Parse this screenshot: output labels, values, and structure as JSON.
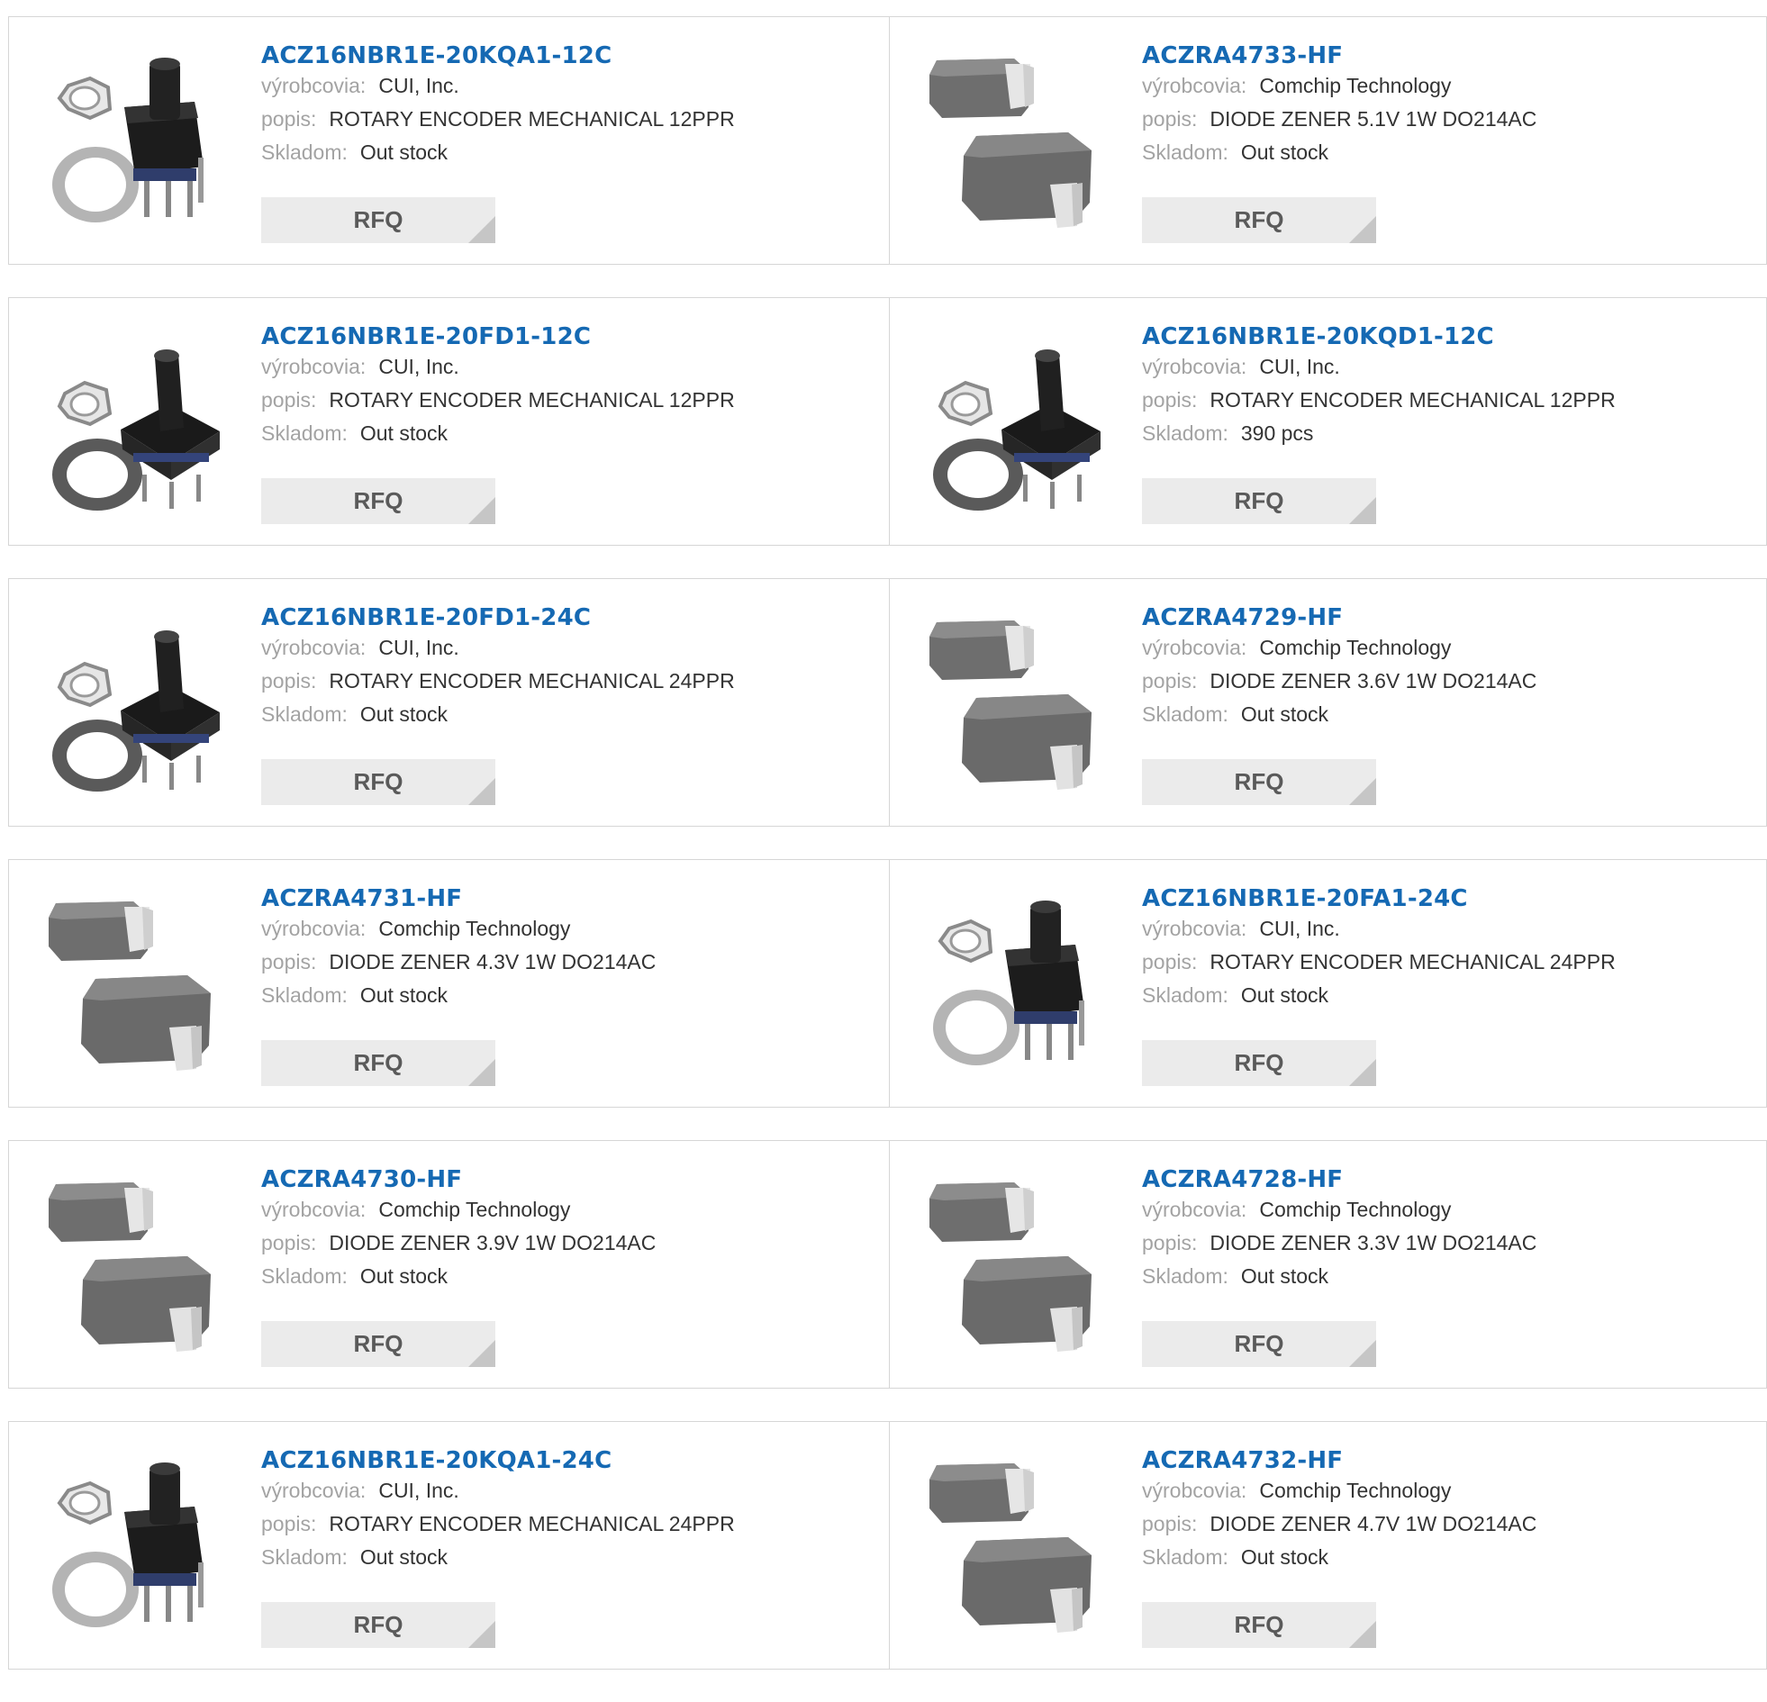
{
  "labels": {
    "manufacturer": "výrobcovia:",
    "description": "popis:",
    "stock": "Skladom:",
    "rfq": "RFQ"
  },
  "products": [
    {
      "part": "ACZ16NBR1E-20KQA1-12C",
      "manufacturer": "CUI, Inc.",
      "description": "ROTARY ENCODER MECHANICAL 12PPR",
      "stock": "Out stock",
      "image": "rotary-encoder"
    },
    {
      "part": "ACZRA4733-HF",
      "manufacturer": "Comchip Technology",
      "description": "DIODE ZENER 5.1V 1W DO214AC",
      "stock": "Out stock",
      "image": "zener-diode"
    },
    {
      "part": "ACZ16NBR1E-20FD1-12C",
      "manufacturer": "CUI, Inc.",
      "description": "ROTARY ENCODER MECHANICAL 12PPR",
      "stock": "Out stock",
      "image": "rotary-encoder-d"
    },
    {
      "part": "ACZ16NBR1E-20KQD1-12C",
      "manufacturer": "CUI, Inc.",
      "description": "ROTARY ENCODER MECHANICAL 12PPR",
      "stock": "390 pcs",
      "image": "rotary-encoder-d"
    },
    {
      "part": "ACZ16NBR1E-20FD1-24C",
      "manufacturer": "CUI, Inc.",
      "description": "ROTARY ENCODER MECHANICAL 24PPR",
      "stock": "Out stock",
      "image": "rotary-encoder-d"
    },
    {
      "part": "ACZRA4729-HF",
      "manufacturer": "Comchip Technology",
      "description": "DIODE ZENER 3.6V 1W DO214AC",
      "stock": "Out stock",
      "image": "zener-diode"
    },
    {
      "part": "ACZRA4731-HF",
      "manufacturer": "Comchip Technology",
      "description": "DIODE ZENER 4.3V 1W DO214AC",
      "stock": "Out stock",
      "image": "zener-diode"
    },
    {
      "part": "ACZ16NBR1E-20FA1-24C",
      "manufacturer": "CUI, Inc.",
      "description": "ROTARY ENCODER MECHANICAL 24PPR",
      "stock": "Out stock",
      "image": "rotary-encoder"
    },
    {
      "part": "ACZRA4730-HF",
      "manufacturer": "Comchip Technology",
      "description": "DIODE ZENER 3.9V 1W DO214AC",
      "stock": "Out stock",
      "image": "zener-diode"
    },
    {
      "part": "ACZRA4728-HF",
      "manufacturer": "Comchip Technology",
      "description": "DIODE ZENER 3.3V 1W DO214AC",
      "stock": "Out stock",
      "image": "zener-diode"
    },
    {
      "part": "ACZ16NBR1E-20KQA1-24C",
      "manufacturer": "CUI, Inc.",
      "description": "ROTARY ENCODER MECHANICAL 24PPR",
      "stock": "Out stock",
      "image": "rotary-encoder"
    },
    {
      "part": "ACZRA4732-HF",
      "manufacturer": "Comchip Technology",
      "description": "DIODE ZENER 4.7V 1W DO214AC",
      "stock": "Out stock",
      "image": "zener-diode"
    }
  ]
}
